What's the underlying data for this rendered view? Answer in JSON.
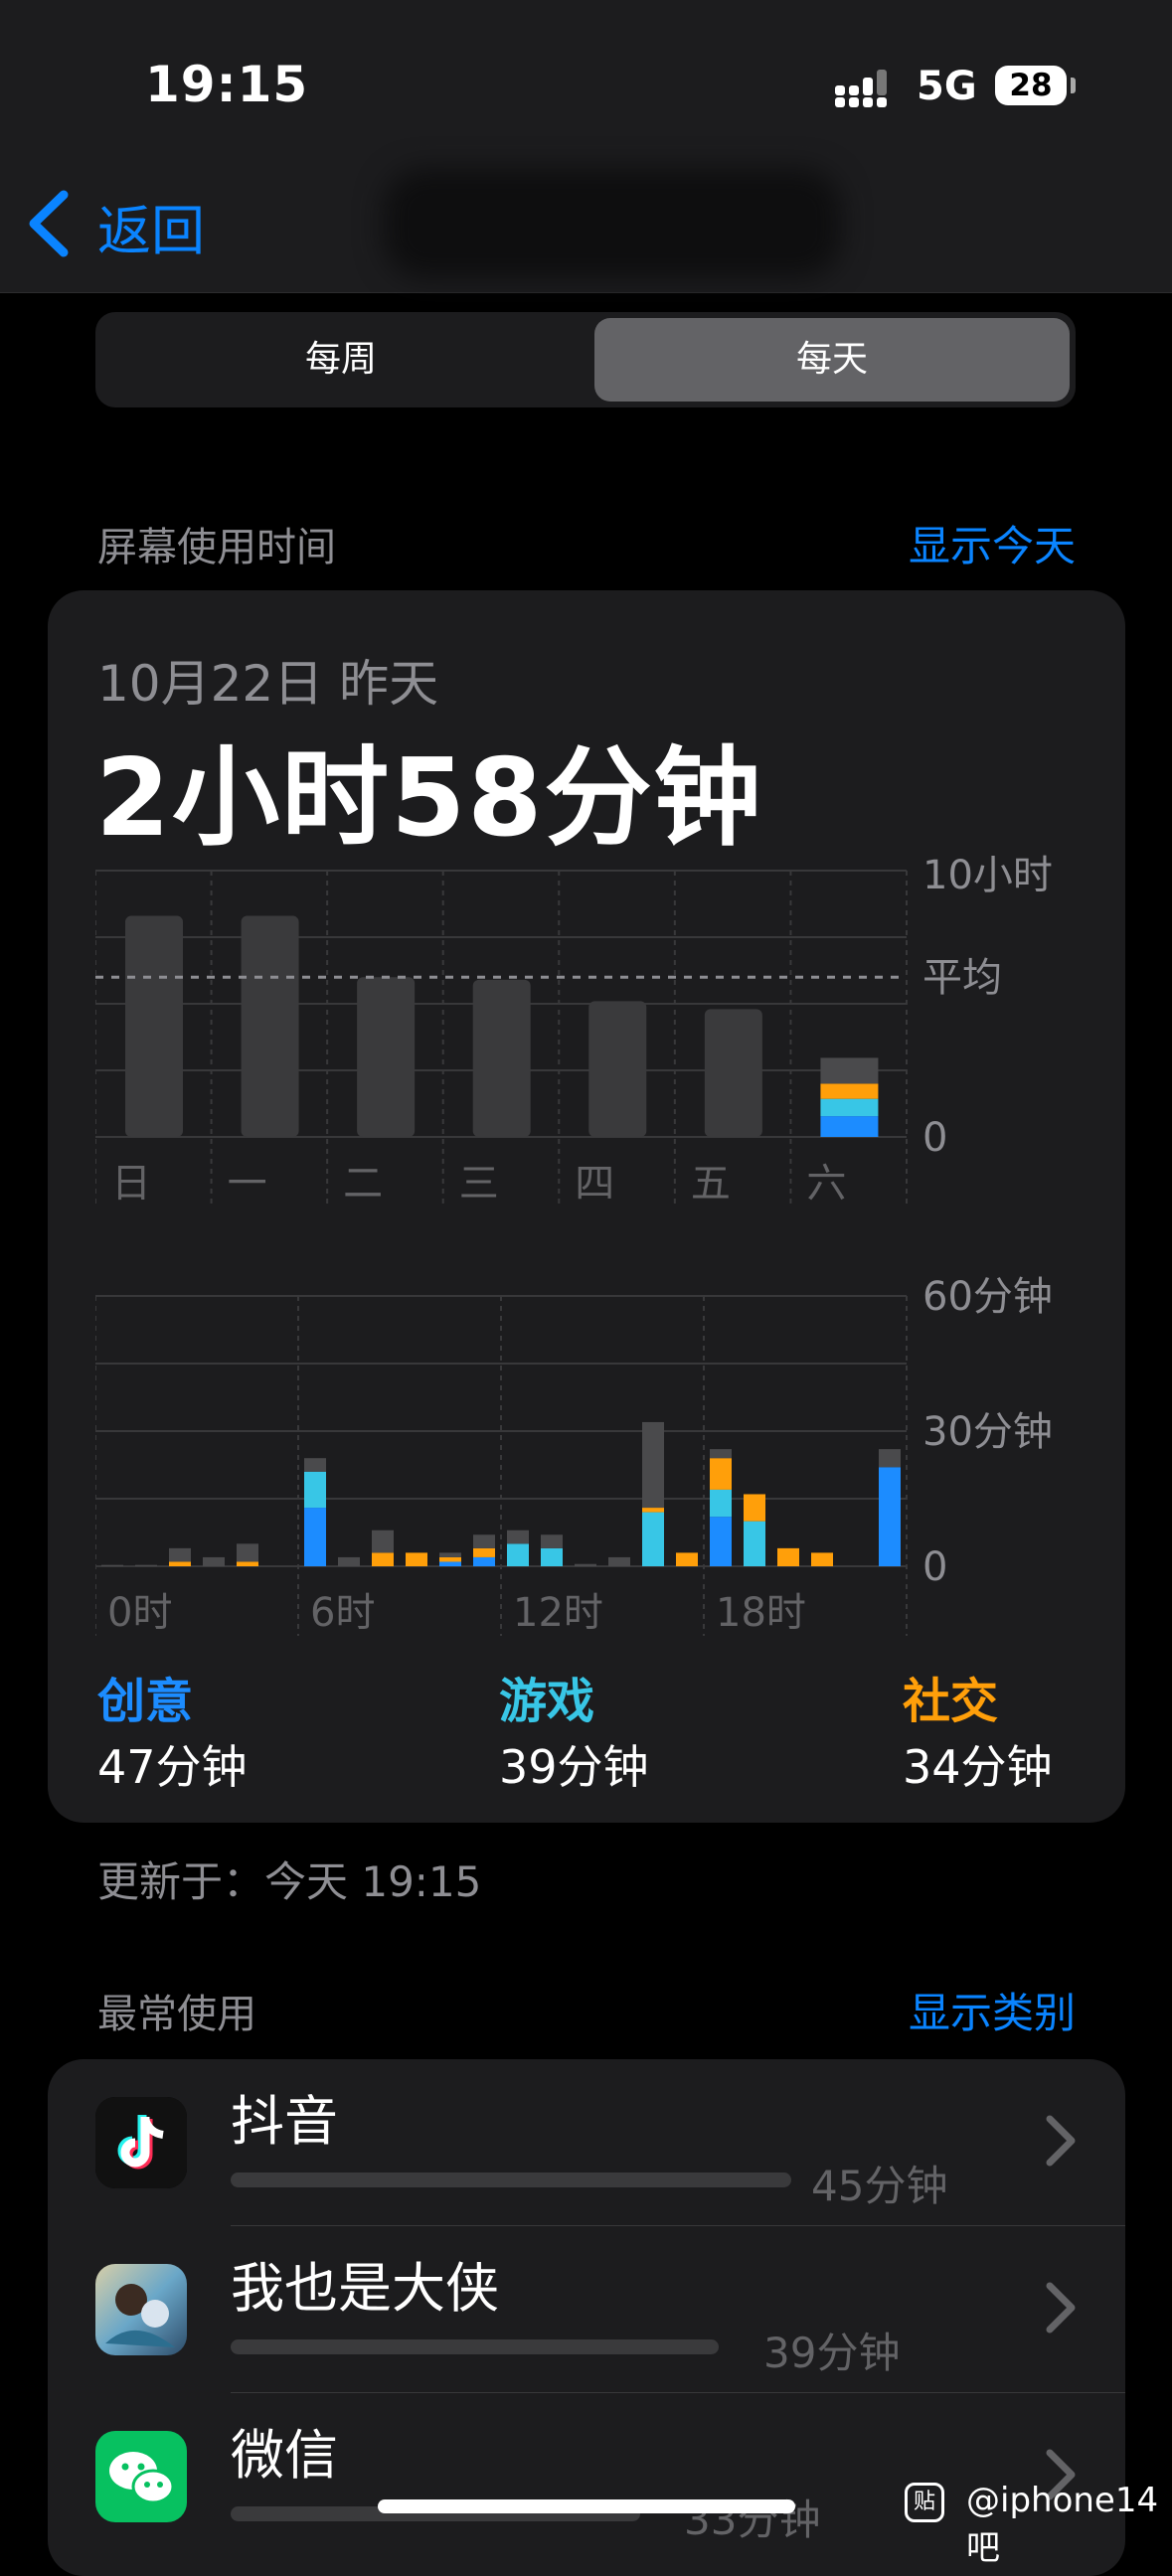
{
  "status_bar": {
    "time": "19:15",
    "network": "5G",
    "battery": "28"
  },
  "nav": {
    "back_label": "返回"
  },
  "segmented": {
    "week": "每周",
    "day": "每天",
    "selected": "day"
  },
  "screen_time": {
    "section_title": "屏幕使用时间",
    "show_today": "显示今天",
    "date_label": "10月22日 昨天",
    "total": "2小时58分钟",
    "updated": "更新于：今天 19:15"
  },
  "colors": {
    "creative": "#1c8cff",
    "games": "#38c6e6",
    "social": "#ff9f0a",
    "other": "#4a4a4c",
    "accent": "#0a84ff"
  },
  "chart_data": [
    {
      "type": "bar",
      "title": "",
      "categories": [
        "日",
        "一",
        "二",
        "三",
        "四",
        "五",
        "六"
      ],
      "axis_labels": {
        "top": "10小时",
        "avg": "平均",
        "bottom": "0"
      },
      "ylim": [
        0,
        10
      ],
      "average_hours": 6.0,
      "series": [
        {
          "name": "total_hours",
          "values": [
            8.3,
            8.3,
            6.0,
            5.9,
            5.1,
            4.8,
            2.97
          ]
        }
      ],
      "stack_day": "六",
      "stack_hours": {
        "creative": 0.78,
        "games": 0.65,
        "social": 0.57,
        "other": 0.97
      }
    },
    {
      "type": "bar",
      "title": "",
      "tick_labels": [
        "0时",
        "6时",
        "12时",
        "18时"
      ],
      "axis_labels": {
        "top": "60分钟",
        "mid": "30分钟",
        "bottom": "0"
      },
      "ylim": [
        0,
        60
      ],
      "categories": [
        "0",
        "1",
        "2",
        "3",
        "4",
        "5",
        "6",
        "7",
        "8",
        "9",
        "10",
        "11",
        "12",
        "13",
        "14",
        "15",
        "16",
        "17",
        "18",
        "19",
        "20",
        "21",
        "22",
        "23"
      ],
      "series": [
        {
          "name": "创意",
          "values": [
            0,
            0,
            0,
            0,
            0,
            0,
            13,
            0,
            0,
            0,
            1,
            2,
            0,
            0,
            0,
            0,
            0,
            0,
            11,
            0,
            0,
            0,
            0,
            22
          ]
        },
        {
          "name": "游戏",
          "values": [
            0,
            0,
            0,
            0,
            0,
            0,
            8,
            0,
            0,
            0,
            0,
            0,
            5,
            4,
            0,
            0,
            12,
            0,
            6,
            10,
            0,
            0,
            0,
            0
          ]
        },
        {
          "name": "社交",
          "values": [
            0,
            0,
            1,
            0,
            1,
            0,
            0,
            0,
            3,
            3,
            1,
            2,
            0,
            0,
            0,
            0,
            1,
            3,
            7,
            6,
            4,
            3,
            0,
            0
          ]
        },
        {
          "name": "其他",
          "values": [
            0.3,
            0.3,
            3,
            2,
            4,
            0,
            3,
            2,
            5,
            0,
            1,
            3,
            3,
            3,
            0.5,
            2,
            19,
            0,
            2,
            0,
            0,
            0,
            0,
            4
          ]
        }
      ]
    }
  ],
  "categories_summary": [
    {
      "name": "创意",
      "time": "47分钟",
      "color": "#1c8cff"
    },
    {
      "name": "游戏",
      "time": "39分钟",
      "color": "#38c6e6"
    },
    {
      "name": "社交",
      "time": "34分钟",
      "color": "#ff9f0a"
    }
  ],
  "most_used": {
    "section_title": "最常使用",
    "show_categories": "显示类别",
    "apps": [
      {
        "name": "抖音",
        "time": "45分钟",
        "icon": "douyin-icon",
        "fraction": 1.0
      },
      {
        "name": "我也是大侠",
        "time": "39分钟",
        "icon": "game-icon",
        "fraction": 0.87
      },
      {
        "name": "微信",
        "time": "33分钟",
        "icon": "wechat-icon",
        "fraction": 0.73
      }
    ]
  },
  "watermark": "@iphone14吧"
}
